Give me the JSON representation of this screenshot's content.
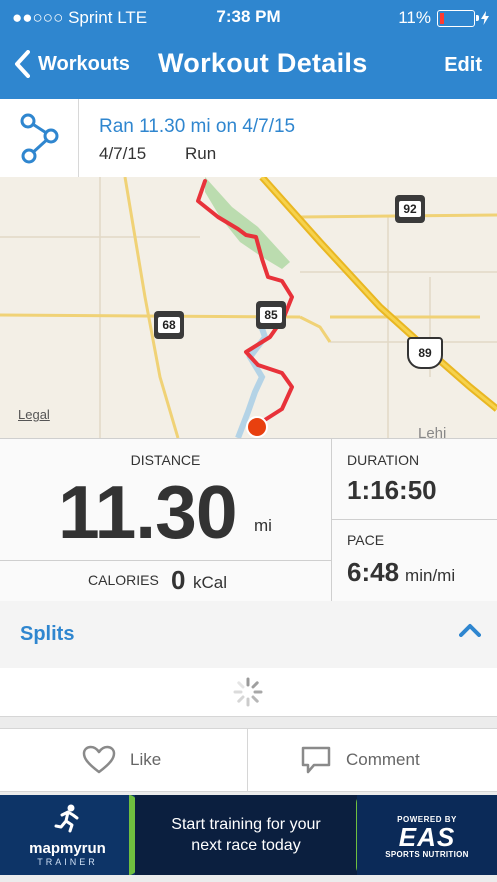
{
  "status_bar": {
    "carrier": "●●○○○ Sprint  LTE",
    "time": "7:38 PM",
    "battery": "11%",
    "battery_level": 0.11
  },
  "navbar": {
    "back_label": "Workouts",
    "title": "Workout Details",
    "edit_label": "Edit",
    "color": "#2f86cf"
  },
  "summary": {
    "icon": "route-icon",
    "headline": "Ran 11.30 mi on 4/7/15",
    "date": "4/7/15",
    "activity": "Run"
  },
  "map": {
    "legal_label": "Legal",
    "route_color": "#e8323a",
    "highway_badges": [
      "92",
      "85",
      "68",
      "89"
    ],
    "partial_place_label": "Lehi"
  },
  "stats": {
    "distance": {
      "label": "DISTANCE",
      "value": "11.30",
      "unit": "mi"
    },
    "calories": {
      "label": "CALORIES",
      "value": "0",
      "unit": "kCal"
    },
    "duration": {
      "label": "DURATION",
      "value": "1:16:50"
    },
    "pace": {
      "label": "PACE",
      "value": "6:48",
      "unit": "min/mi"
    }
  },
  "splits": {
    "label": "Splits",
    "icon": "chevron-up-icon"
  },
  "actions": {
    "like_label": "Like",
    "like_icon": "heart-icon",
    "comment_label": "Comment",
    "comment_icon": "comment-icon"
  },
  "ad": {
    "brand_left": "mapmyrun",
    "brand_left_sub": "TRAINER",
    "message": "Start training for your next race today",
    "powered_by": "POWERED BY",
    "brand_right": "EAS",
    "brand_right_sub": "SPORTS NUTRITION"
  }
}
